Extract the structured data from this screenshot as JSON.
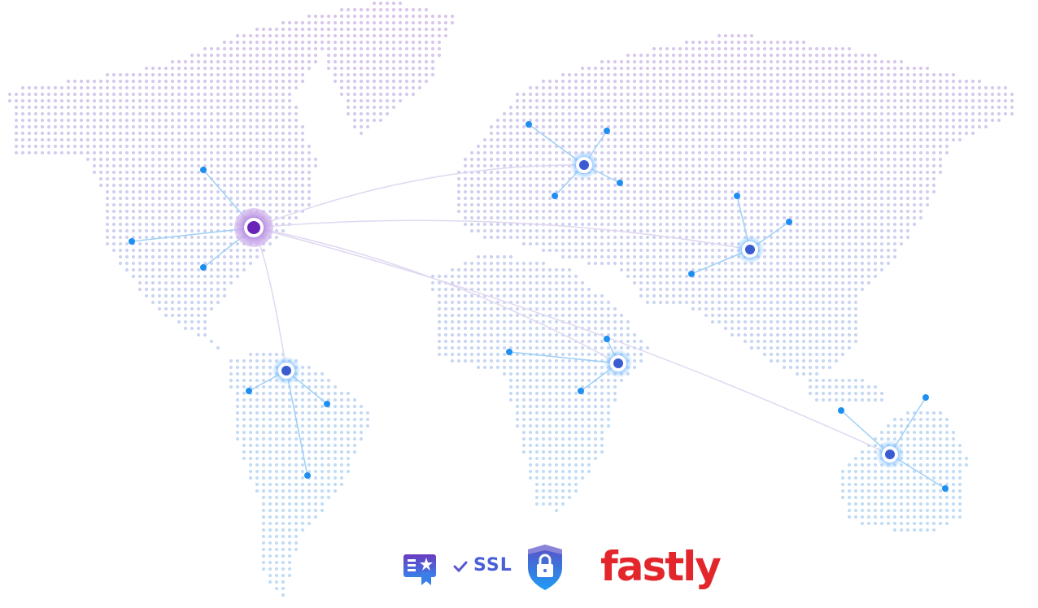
{
  "colors": {
    "dot_top": "#d9c3ec",
    "dot_bottom": "#bfdcf5",
    "hub": "#6a22b8",
    "node": "#3b5cd0",
    "spoke": "#1e8ff0",
    "fastly": "#e3262b"
  },
  "map": {
    "hub_icon": "hub-node",
    "nodes_icon": "regional-node"
  },
  "badges": {
    "certificate_icon": "certificate-icon",
    "ssl_label": "SSL",
    "shield_icon": "shield-lock-icon",
    "fastly_logo": "fastly"
  }
}
